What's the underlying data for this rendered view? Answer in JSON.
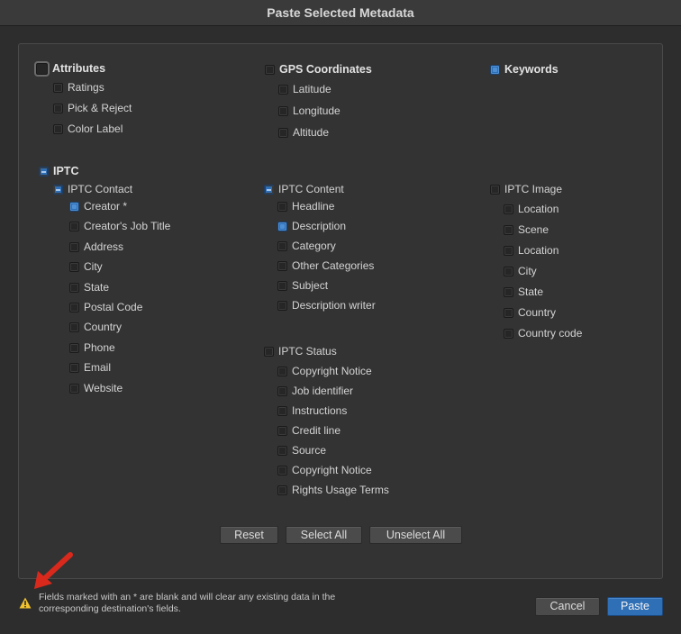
{
  "dialog": {
    "title": "Paste Selected Metadata"
  },
  "attributes": {
    "label": "Attributes",
    "items": [
      "Ratings",
      "Pick & Reject",
      "Color Label"
    ]
  },
  "gps": {
    "label": "GPS Coordinates",
    "items": [
      "Latitude",
      "Longitude",
      "Altitude"
    ]
  },
  "keywords": {
    "label": "Keywords"
  },
  "iptc": {
    "label": "IPTC",
    "contact": {
      "label": "IPTC Contact",
      "items": [
        "Creator *",
        "Creator's Job Title",
        "Address",
        "City",
        "State",
        "Postal Code",
        "Country",
        "Phone",
        "Email",
        "Website"
      ]
    },
    "content": {
      "label": "IPTC Content",
      "items": [
        "Headline",
        "Description",
        "Category",
        "Other Categories",
        "Subject",
        "Description writer"
      ]
    },
    "status": {
      "label": "IPTC Status",
      "items": [
        "Copyright Notice",
        "Job identifier",
        "Instructions",
        "Credit line",
        "Source",
        "Copyright Notice",
        "Rights Usage Terms"
      ]
    },
    "image": {
      "label": "IPTC Image",
      "items": [
        "Location",
        "Scene",
        "Location",
        "City",
        "State",
        "Country",
        "Country code"
      ]
    }
  },
  "buttons": {
    "reset": "Reset",
    "select_all": "Select All",
    "unselect_all": "Unselect All",
    "cancel": "Cancel",
    "paste": "Paste"
  },
  "footer": {
    "note": "Fields marked with an * are blank and will clear any existing data in the corresponding destination's fields."
  },
  "colors": {
    "accent": "#2f6fb6",
    "warning": "#f2c12e",
    "annotation_arrow": "#d9291c"
  }
}
